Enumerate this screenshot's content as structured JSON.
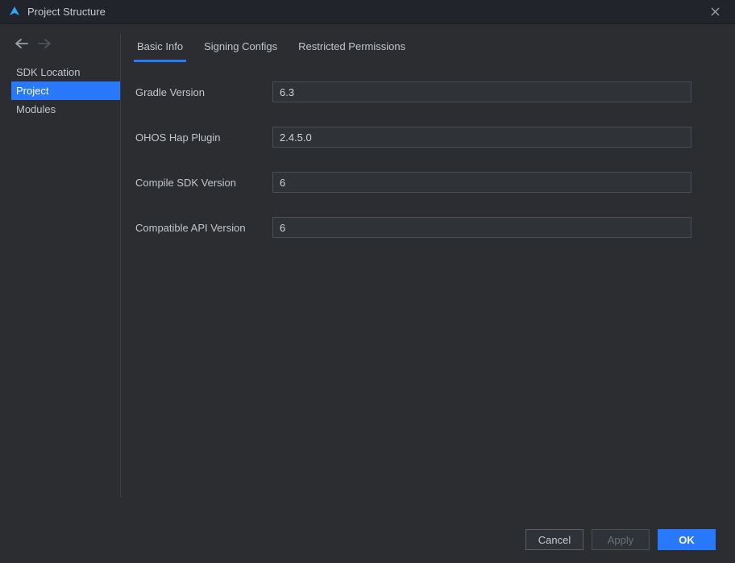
{
  "window": {
    "title": "Project Structure"
  },
  "sidebar": {
    "items": [
      {
        "label": "SDK Location",
        "selected": false
      },
      {
        "label": "Project",
        "selected": true
      },
      {
        "label": "Modules",
        "selected": false
      }
    ]
  },
  "tabs": [
    {
      "label": "Basic Info",
      "active": true
    },
    {
      "label": "Signing Configs",
      "active": false
    },
    {
      "label": "Restricted Permissions",
      "active": false
    }
  ],
  "form": {
    "gradle_version": {
      "label": "Gradle Version",
      "value": "6.3"
    },
    "ohos_hap_plugin": {
      "label": "OHOS Hap Plugin",
      "value": "2.4.5.0"
    },
    "compile_sdk_version": {
      "label": "Compile SDK Version",
      "value": "6"
    },
    "compatible_api_version": {
      "label": "Compatible API Version",
      "value": "6"
    }
  },
  "buttons": {
    "cancel": "Cancel",
    "apply": "Apply",
    "ok": "OK"
  }
}
